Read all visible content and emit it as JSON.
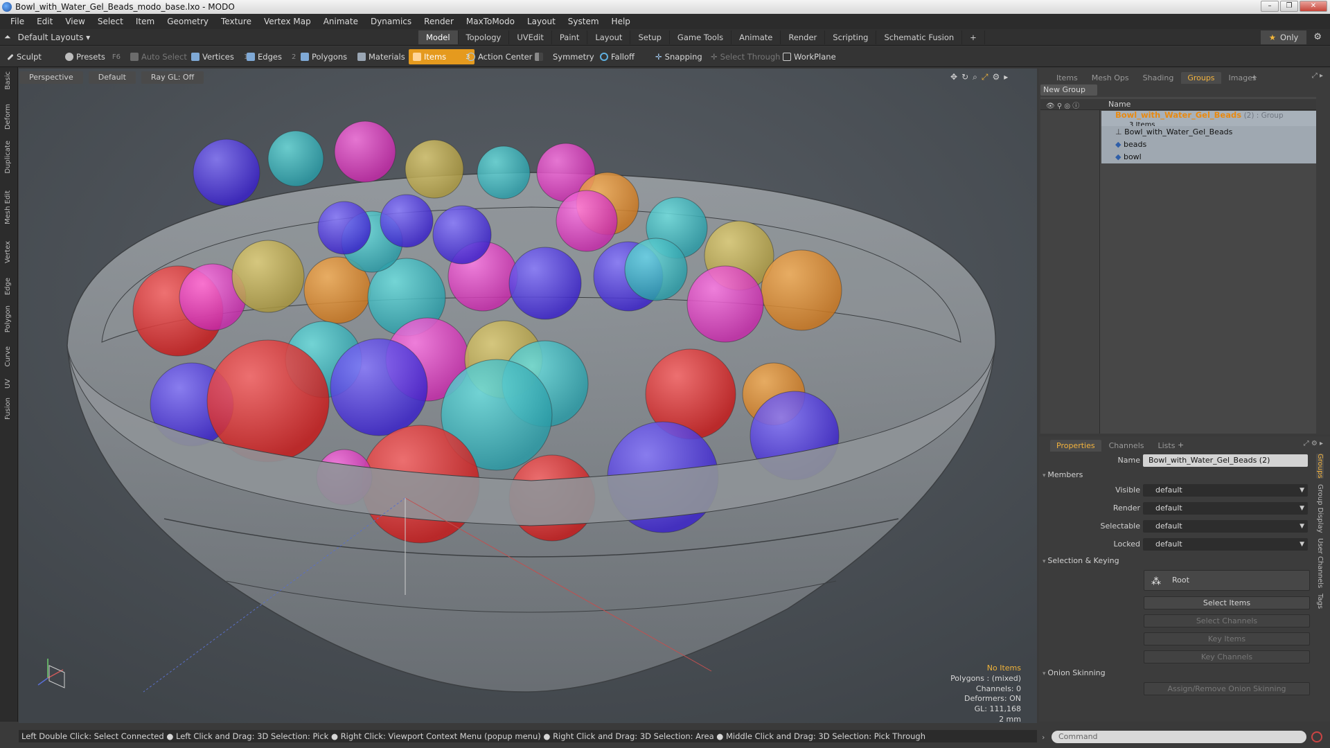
{
  "window": {
    "title": "Bowl_with_Water_Gel_Beads_modo_base.lxo - MODO",
    "min": "–",
    "max": "❐",
    "close": "✕"
  },
  "menu": [
    "File",
    "Edit",
    "View",
    "Select",
    "Item",
    "Geometry",
    "Texture",
    "Vertex Map",
    "Animate",
    "Dynamics",
    "Render",
    "MaxToModo",
    "Layout",
    "System",
    "Help"
  ],
  "layoutbar": {
    "layouts_label": "Default Layouts",
    "tabs": [
      "Model",
      "Topology",
      "UVEdit",
      "Paint",
      "Layout",
      "Setup",
      "Game Tools",
      "Animate",
      "Render",
      "Scripting",
      "Schematic Fusion"
    ],
    "active_tab": "Model",
    "add": "+",
    "only_label": "Only",
    "gear": "⚙"
  },
  "toolbar": {
    "sculpt": "Sculpt",
    "presets": "Presets",
    "presets_key": "F6",
    "auto_select": "Auto Select",
    "vertices": "Vertices",
    "vertices_count": "1",
    "edges": "Edges",
    "edges_count": "2",
    "polygons": "Polygons",
    "materials": "Materials",
    "items": "Items",
    "items_count": "3",
    "action_center": "Action Center",
    "symmetry": "Symmetry",
    "falloff": "Falloff",
    "snapping": "Snapping",
    "select_through": "Select Through",
    "workplane": "WorkPlane"
  },
  "left_tabs": [
    "Basic",
    "Deform",
    "Duplicate",
    "Mesh Edit",
    "Vertex",
    "Edge",
    "Polygon",
    "Curve",
    "UV",
    "Fusion"
  ],
  "viewport": {
    "view": "Perspective",
    "shading": "Default",
    "raygl": "Ray GL: Off",
    "info": {
      "selection": "No Items",
      "polygons": "Polygons : (mixed)",
      "channels": "Channels: 0",
      "deformers": "Deformers: ON",
      "gl": "GL: 111,168",
      "scale": "2 mm"
    }
  },
  "status": "Left Double Click: Select Connected ● Left Click and Drag: 3D Selection: Pick ● Right Click: Viewport Context Menu (popup menu) ● Right Click and Drag: 3D Selection: Area ● Middle Click and Drag: 3D Selection: Pick Through",
  "top_panel": {
    "tabs": [
      "Items",
      "Mesh Ops",
      "Shading",
      "Groups",
      "Images"
    ],
    "active": "Groups",
    "new_group": "New Group",
    "col_name": "Name",
    "group": {
      "name": "Bowl_with_Water_Gel_Beads",
      "suffix": "(2) : Group",
      "count": "3 Items"
    },
    "children": [
      "Bowl_with_Water_Gel_Beads",
      "beads",
      "bowl"
    ]
  },
  "properties": {
    "tabs": [
      "Properties",
      "Channels",
      "Lists"
    ],
    "active": "Properties",
    "name_label": "Name",
    "name_value": "Bowl_with_Water_Gel_Beads (2)",
    "members_label": "Members",
    "fields": [
      {
        "label": "Visible",
        "value": "default"
      },
      {
        "label": "Render",
        "value": "default"
      },
      {
        "label": "Selectable",
        "value": "default"
      },
      {
        "label": "Locked",
        "value": "default"
      }
    ],
    "sel_keying_label": "Selection & Keying",
    "root_label": "Root",
    "select_items": "Select Items",
    "select_channels": "Select Channels",
    "key_items": "Key Items",
    "key_channels": "Key Channels",
    "onion_label": "Onion Skinning",
    "onion_button": "Assign/Remove Onion Skinning",
    "side_tabs": [
      "Groups",
      "Group Display",
      "User Channels",
      "Tags"
    ]
  },
  "command_placeholder": "Command"
}
